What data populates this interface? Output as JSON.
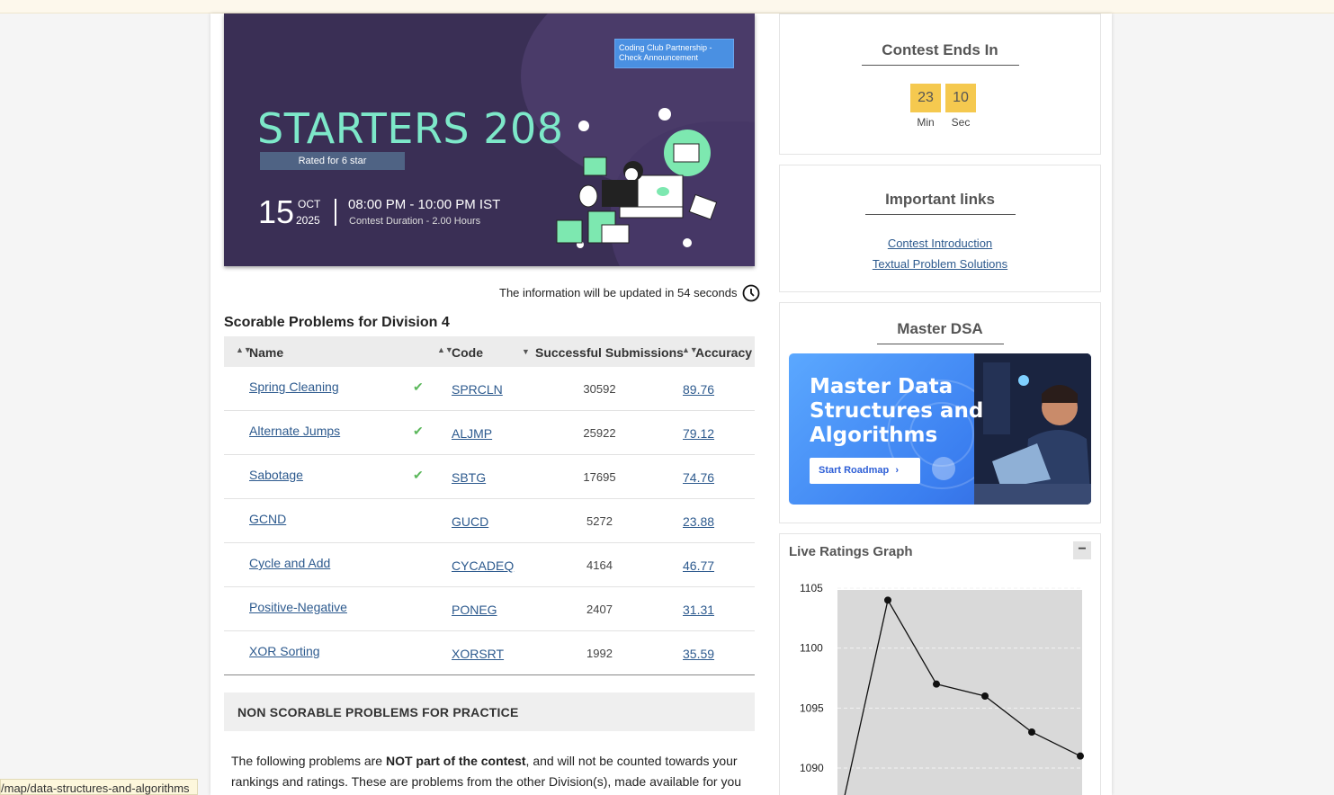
{
  "status_url": "/map/data-structures-and-algorithms",
  "banner": {
    "announcement": "Coding Club Partnership - Check Announcement",
    "title": "STARTERS 208",
    "rated": "Rated for 6 star",
    "day": "15",
    "month": "OCT",
    "year": "2025",
    "time": "08:00 PM - 10:00 PM IST",
    "duration": "Contest Duration - 2.00 Hours"
  },
  "update_note": "The information will be updated in 54 seconds",
  "problems": {
    "section_title": "Scorable Problems for Division 4",
    "headers": {
      "name": "Name",
      "code": "Code",
      "submissions": "Successful Submissions",
      "accuracy": "Accuracy"
    },
    "rows": [
      {
        "name": "Spring Cleaning",
        "solved": true,
        "code": "SPRCLN",
        "submissions": "30592",
        "accuracy": "89.76"
      },
      {
        "name": "Alternate Jumps",
        "solved": true,
        "code": "ALJMP",
        "submissions": "25922",
        "accuracy": "79.12"
      },
      {
        "name": "Sabotage",
        "solved": true,
        "code": "SBTG",
        "submissions": "17695",
        "accuracy": "74.76"
      },
      {
        "name": "GCND",
        "solved": false,
        "code": "GUCD",
        "submissions": "5272",
        "accuracy": "23.88"
      },
      {
        "name": "Cycle and Add",
        "solved": false,
        "code": "CYCADEQ",
        "submissions": "4164",
        "accuracy": "46.77"
      },
      {
        "name": "Positive-Negative",
        "solved": false,
        "code": "PONEG",
        "submissions": "2407",
        "accuracy": "31.31"
      },
      {
        "name": "XOR Sorting",
        "solved": false,
        "code": "XORSRT",
        "submissions": "1992",
        "accuracy": "35.59"
      }
    ]
  },
  "non_scorable": {
    "title": "NON SCORABLE PROBLEMS FOR PRACTICE",
    "text_before": "The following problems are ",
    "text_bold": "NOT part of the contest",
    "text_after": ", and will not be counted towards your rankings and ratings. These are problems from the other Division(s), made available for you"
  },
  "contest_ends": {
    "title": "Contest Ends In",
    "minutes": "23",
    "minutes_label": "Min",
    "seconds": "10",
    "seconds_label": "Sec"
  },
  "important_links": {
    "title": "Important links",
    "links": [
      "Contest Introduction",
      "Textual Problem Solutions"
    ]
  },
  "master_dsa": {
    "title": "Master DSA",
    "heading": "Master Data Structures and Algorithms",
    "button": "Start Roadmap"
  },
  "ratings_graph": {
    "title": "Live Ratings Graph",
    "collapse_symbol": "−"
  },
  "chart_data": {
    "type": "line",
    "yticks": [
      1090,
      1095,
      1100,
      1105
    ],
    "ylim": [
      1087,
      1105.2
    ],
    "x": [
      1,
      2,
      3,
      4,
      5,
      6
    ],
    "values": [
      1087,
      1104,
      1097,
      1096,
      1093,
      1091
    ],
    "grid": true,
    "background": "#d9d9d9"
  }
}
